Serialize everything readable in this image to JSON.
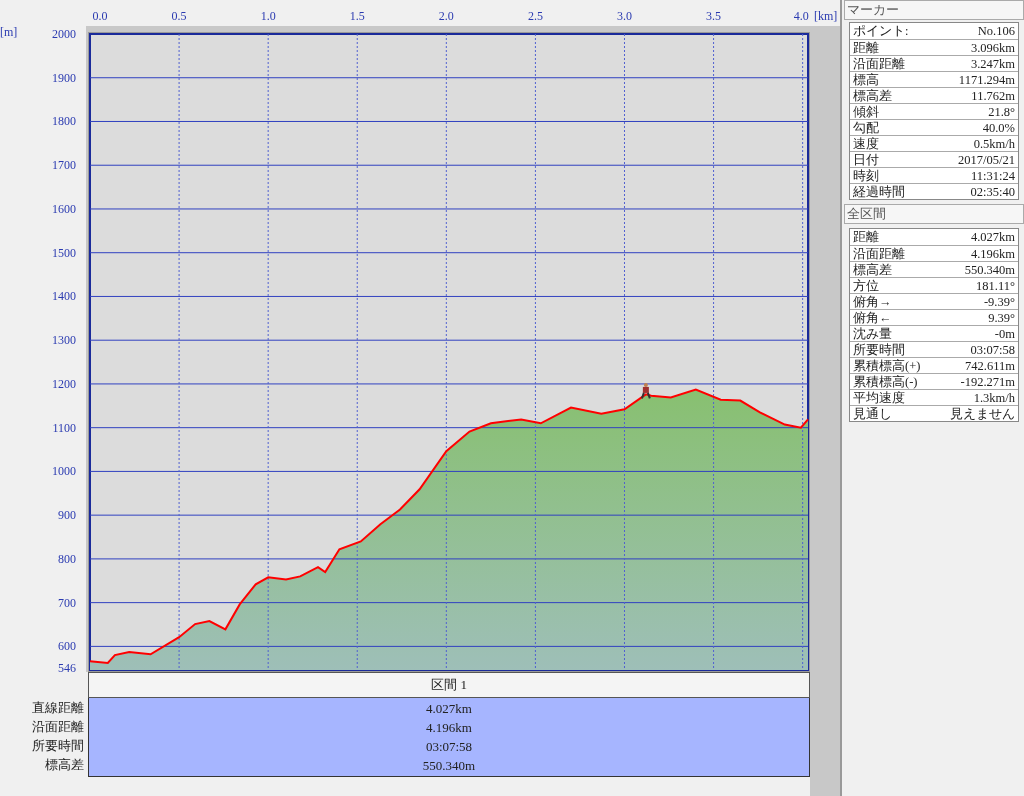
{
  "chart": {
    "chart_data": {
      "type": "area",
      "grid": true,
      "xlabel": "[km]",
      "ylabel": "[m]",
      "x": [
        0,
        0.1,
        0.14,
        0.22,
        0.34,
        0.5,
        0.59,
        0.67,
        0.76,
        0.84,
        0.93,
        1.0,
        1.1,
        1.18,
        1.28,
        1.32,
        1.4,
        1.52,
        1.63,
        1.74,
        1.85,
        2.0,
        2.13,
        2.25,
        2.42,
        2.53,
        2.7,
        2.87,
        3.0,
        3.12,
        3.15,
        3.26,
        3.4,
        3.54,
        3.65,
        3.76,
        3.9,
        3.99,
        4.03
      ],
      "series": [
        {
          "color": "#ff0000",
          "values": [
            566,
            562,
            580,
            587,
            582,
            621,
            651,
            658,
            639,
            696,
            742,
            758,
            753,
            760,
            781,
            770,
            822,
            840,
            879,
            913,
            959,
            1046,
            1091,
            1110,
            1119,
            1110,
            1146,
            1132,
            1142,
            1176,
            1173,
            1169,
            1187,
            1164,
            1162,
            1135,
            1107,
            1100,
            1119
          ]
        }
      ],
      "xlim": [
        0,
        4.03
      ],
      "ylim": [
        546,
        2000
      ],
      "xticks": [
        {
          "value": 0,
          "label": "0.0"
        },
        {
          "value": 0.5,
          "label": "0.5"
        },
        {
          "value": 1,
          "label": "1.0"
        },
        {
          "value": 1.5,
          "label": "1.5"
        },
        {
          "value": 2,
          "label": "2.0"
        },
        {
          "value": 2.5,
          "label": "2.5"
        },
        {
          "value": 3,
          "label": "3.0"
        },
        {
          "value": 3.5,
          "label": "3.5"
        },
        {
          "value": 4,
          "label": "4.0"
        }
      ],
      "yticks": [
        546,
        600,
        700,
        800,
        900,
        1000,
        1100,
        1200,
        1300,
        1400,
        1500,
        1600,
        1700,
        1800,
        1900,
        2000
      ]
    }
  },
  "section_table": {
    "header": "区間 1",
    "rows": [
      {
        "label": "直線距離",
        "value": "4.027km"
      },
      {
        "label": "沿面距離",
        "value": "4.196km"
      },
      {
        "label": "所要時間",
        "value": "03:07:58"
      },
      {
        "label": "標高差",
        "value": "550.340m"
      }
    ]
  },
  "marker_panel": {
    "title": "マーカー",
    "rows": [
      {
        "label": "ポイント:",
        "value": "No.106"
      },
      {
        "label": "距離",
        "value": "3.096km"
      },
      {
        "label": "沿面距離",
        "value": "3.247km"
      },
      {
        "label": "標高",
        "value": "1171.294m"
      },
      {
        "label": "標高差",
        "value": "11.762m"
      },
      {
        "label": "傾斜",
        "value": "21.8°"
      },
      {
        "label": "勾配",
        "value": "40.0%"
      },
      {
        "label": "速度",
        "value": "0.5km/h"
      },
      {
        "label": "日付",
        "value": "2017/05/21"
      },
      {
        "label": "時刻",
        "value": "11:31:24"
      },
      {
        "label": "経過時間",
        "value": "02:35:40"
      }
    ]
  },
  "total_panel": {
    "title": "全区間",
    "rows": [
      {
        "label": "距離",
        "value": "4.027km"
      },
      {
        "label": "沿面距離",
        "value": "4.196km"
      },
      {
        "label": "標高差",
        "value": "550.340m"
      },
      {
        "label": "方位",
        "value": "181.11°"
      },
      {
        "label": "俯角→",
        "value": "-9.39°"
      },
      {
        "label": "俯角←",
        "value": "9.39°"
      },
      {
        "label": "沈み量",
        "value": "-0m"
      },
      {
        "label": "所要時間",
        "value": "03:07:58"
      },
      {
        "label": "累積標高(+)",
        "value": "742.611m"
      },
      {
        "label": "累積標高(-)",
        "value": "-192.271m"
      },
      {
        "label": "平均速度",
        "value": "1.3km/h"
      },
      {
        "label": "見通し",
        "value": "見えません"
      }
    ]
  }
}
